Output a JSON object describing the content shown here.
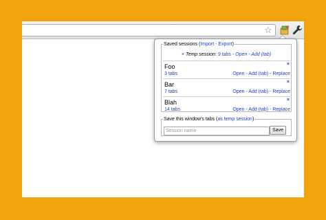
{
  "colors": {
    "background": "#F0A30A",
    "link": "#1a3fcc"
  },
  "toolbar": {
    "icons": [
      "star-icon",
      "extension-icon",
      "wrench-icon"
    ]
  },
  "popup": {
    "saved_legend_prefix": "Saved sessions (",
    "import_label": "Import",
    "export_label": "Export",
    "legend_suffix": ")",
    "temp_close": "×",
    "temp_prefix": "Temp session:",
    "temp_tabs": "9 tabs",
    "temp_open": "Open",
    "temp_add": "Add (tab)",
    "sessions": [
      {
        "name": "Foo",
        "tabs": "3 tabs",
        "open": "Open",
        "add": "Add (tab)",
        "replace": "Replace",
        "close": "×"
      },
      {
        "name": "Bar",
        "tabs": "7 tabs",
        "open": "Open",
        "add": "Add (tab)",
        "replace": "Replace",
        "close": "×"
      },
      {
        "name": "Blah",
        "tabs": "14 tabs",
        "open": "Open",
        "add": "Add (tab)",
        "replace": "Replace",
        "close": "×"
      }
    ],
    "save_legend_prefix": "Save this window's tabs (",
    "as_temp_label": "as temp session",
    "save_legend_suffix": ")",
    "session_name_placeholder": "Session name",
    "save_button": "Save"
  }
}
